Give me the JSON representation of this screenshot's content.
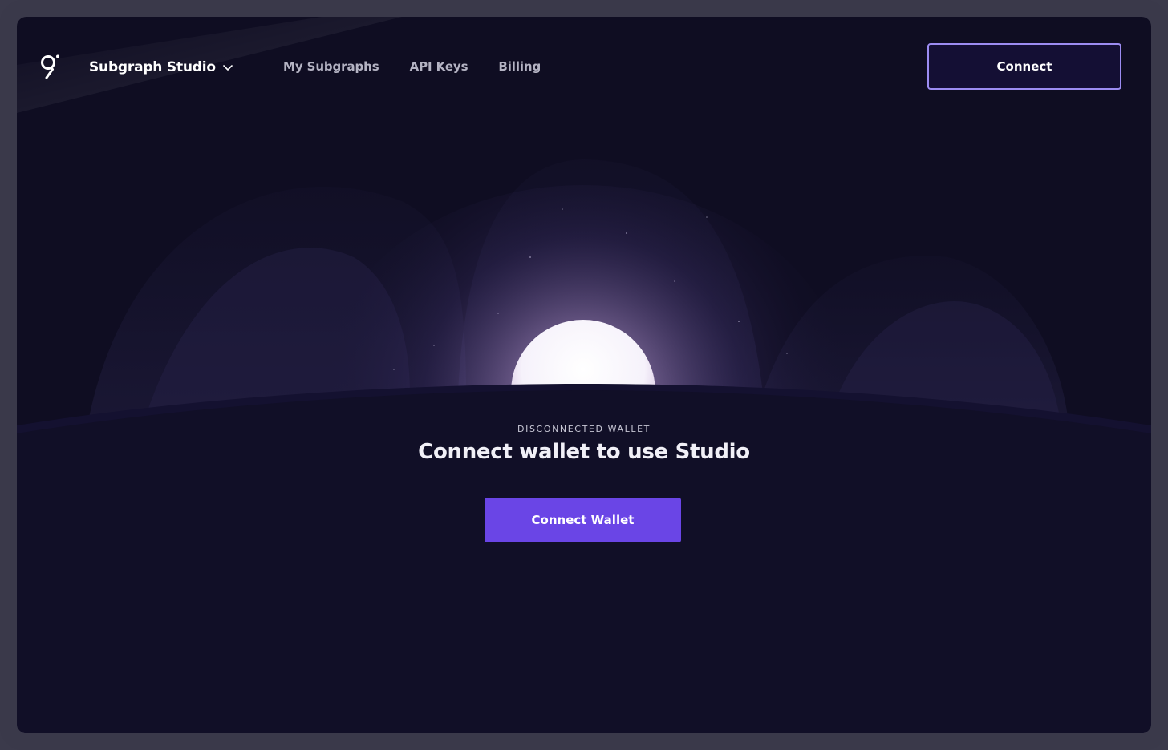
{
  "app": {
    "title": "Subgraph Studio",
    "logo_icon": "graph-logo-icon",
    "switch_icon": "chevron-down-icon"
  },
  "nav": {
    "items": [
      {
        "label": "My Subgraphs"
      },
      {
        "label": "API Keys"
      },
      {
        "label": "Billing"
      }
    ]
  },
  "header": {
    "connect_label": "Connect"
  },
  "main": {
    "eyebrow": "DISCONNECTED WALLET",
    "headline": "Connect wallet to use Studio",
    "connect_wallet_label": "Connect Wallet",
    "illustration": "planet-sunrise-illustration"
  },
  "colors": {
    "background": "#0f0d22",
    "accent": "#6a45e6",
    "outline_button_border": "#9c8cf2",
    "frame": "#3a394a"
  }
}
